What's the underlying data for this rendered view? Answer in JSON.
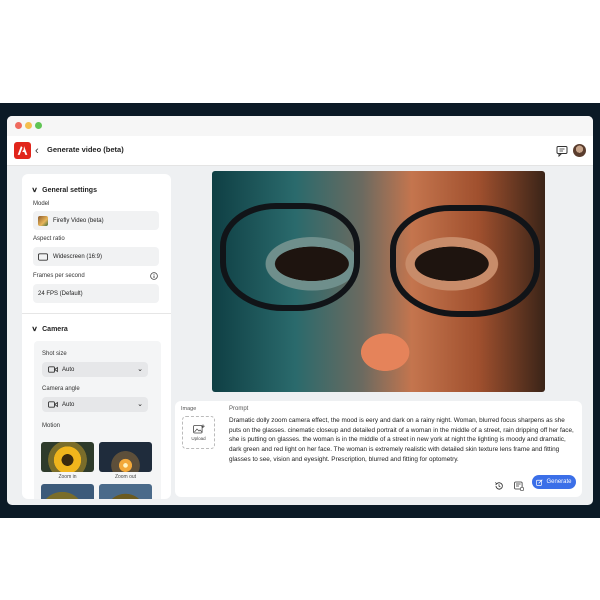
{
  "app": {
    "title": "Generate video (beta)"
  },
  "sidebar": {
    "general_heading": "General settings",
    "model_label": "Model",
    "model_value": "Firefly Video (beta)",
    "aspect_label": "Aspect ratio",
    "aspect_value": "Widescreen (16:9)",
    "fps_label": "Frames per second",
    "fps_value": "24 FPS (Default)",
    "camera_heading": "Camera",
    "shot_size_label": "Shot size",
    "shot_size_value": "Auto",
    "camera_angle_label": "Camera angle",
    "camera_angle_value": "Auto",
    "motion_label": "Motion",
    "motion_options": [
      "Zoom in",
      "Zoom out"
    ]
  },
  "prompt_area": {
    "image_label": "Image",
    "upload_label": "Upload",
    "prompt_label": "Prompt",
    "prompt_text": "Dramatic dolly zoom camera effect, the mood is eery and dark on a rainy night. Woman, blurred focus sharpens as she puts on the glasses. cinematic closeup and detailed portrait of a woman in the middle of a street, rain dripping off her face, she is putting on glasses. the woman is in the middle of a street in new york at night the lighting is moody and dramatic, dark green and red light on her face. The woman is extremely realistic with detailed skin texture lens frame and fitting glasses to see, vision and eyesight. Prescription, blurred and fitting for optometry.",
    "generate_label": "Generate"
  },
  "colors": {
    "brand": "#e1251b",
    "accent": "#3b6fe8",
    "frame": "#0b1a26"
  }
}
